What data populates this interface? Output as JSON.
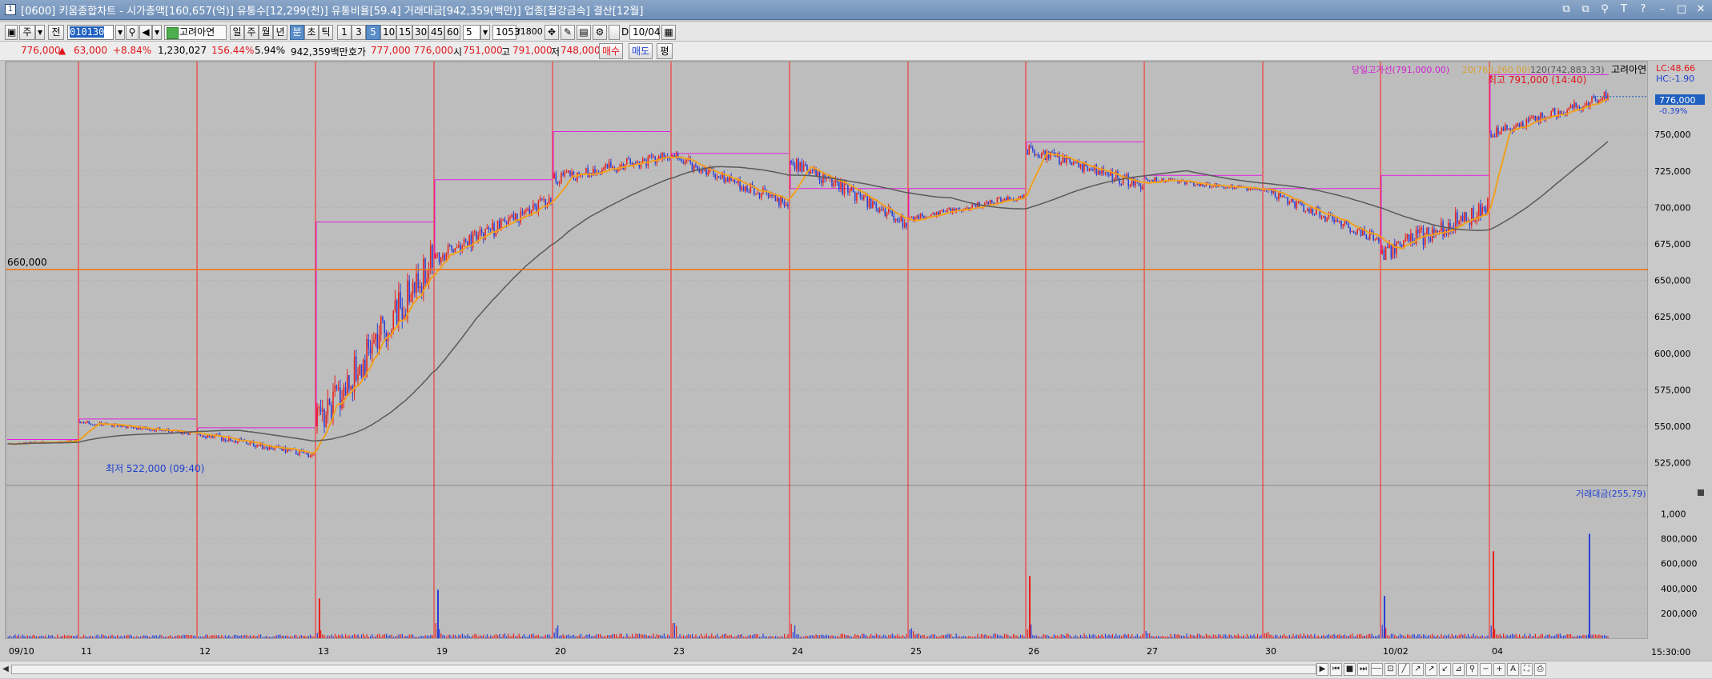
{
  "window": {
    "title": "[0600] 키움종합차트 - 시가총액[160,657(억)] 유통수[12,299(천)] 유통비율[59.4] 거래대금[942,359(백만)] 업종[철강금속] 결산[12월]",
    "app_icon": "1",
    "buttons": [
      "⧉",
      "⧉",
      "⚲",
      "T",
      "?",
      "–",
      "□",
      "✕"
    ]
  },
  "toolbar": {
    "type_label": "주",
    "prev_label": "전",
    "code_value": "010130",
    "stock_name": "고려아연",
    "periods": [
      "일",
      "주",
      "월",
      "년",
      "분",
      "초",
      "틱"
    ],
    "active_period": "분",
    "intervals": [
      "1",
      "3",
      "5",
      "10",
      "15",
      "30",
      "45",
      "60"
    ],
    "active_interval": "5",
    "interval_select": "5",
    "count_value": "1053",
    "count_total": "/1800",
    "date_value": "10/04"
  },
  "quote": {
    "price": "776,000",
    "change_arrow": "▲",
    "change": "63,000",
    "change_pct": "+8.84%",
    "volume": "1,230,027",
    "volume_ratio": "156.44%",
    "turnover": "5.94%",
    "trade_amount": "942,359백만",
    "ask_label": "호가",
    "ask_values": "777,000 776,000",
    "open_label": "시",
    "open_value": "751,000",
    "high_label": "고",
    "high_value": "791,000",
    "low_label": "저",
    "low_value": "748,000",
    "buy_label": "매수",
    "sell_label": "매도",
    "avg_label": "평"
  },
  "legend": {
    "prev_high_line": "당일고가선(791,000.00)",
    "ma_short": "20(760,260.00)",
    "ma_long": "120(742,883.33)",
    "stock": "고려아연",
    "lc": "LC:48.66",
    "hc": "HC:-1.90",
    "price_flag": "776,000",
    "price_flag_pct": "-0.39%",
    "volume_panel": "거래대금(255,79)"
  },
  "annotations": {
    "high": "최고 791,000 (14:40)",
    "low": "최저 522,000 (09:40)",
    "ref_line": "660,000"
  },
  "axis": {
    "price_ticks": [
      "750,000",
      "725,000",
      "700,000",
      "675,000",
      "650,000",
      "625,000",
      "600,000",
      "575,000",
      "550,000",
      "525,000"
    ],
    "volume_ticks": [
      "1,000",
      "800,000",
      "600,000",
      "400,000",
      "200,000"
    ],
    "dates": [
      "09/10",
      "11",
      "12",
      "13",
      "19",
      "20",
      "23",
      "24",
      "25",
      "26",
      "27",
      "30",
      "10/02",
      "04"
    ],
    "time_label": "15:30:00"
  },
  "colors": {
    "up": "#e8201a",
    "down": "#2a3fd6",
    "ma20": "#f0a020",
    "ma120": "#5a5a5a",
    "day_high_line": "#e020e0",
    "ref_line": "#f07010",
    "session_line": "#ff2020",
    "panel_bg": "#bdbdbd"
  },
  "chart_data": {
    "type": "candlestick",
    "title": "",
    "xlabel": "",
    "ylabel": "",
    "ylim": [
      510000,
      800000
    ],
    "volume_ylim": [
      0,
      1100
    ],
    "sessions": [
      {
        "date": "09/10",
        "open": 538000,
        "high": 542000,
        "low": 534000,
        "close": 540000,
        "day_high": 541000
      },
      {
        "date": "11",
        "open": 553000,
        "high": 555000,
        "low": 540000,
        "close": 545000,
        "day_high": 555000
      },
      {
        "date": "12",
        "open": 545000,
        "high": 548000,
        "low": 522000,
        "close": 530000,
        "day_high": 549000
      },
      {
        "date": "13",
        "open": 550000,
        "high": 690000,
        "low": 545000,
        "close": 663000,
        "day_high": 690000
      },
      {
        "date": "19",
        "open": 665000,
        "high": 720000,
        "low": 660000,
        "close": 705000,
        "day_high": 719000
      },
      {
        "date": "20",
        "open": 720000,
        "high": 752000,
        "low": 705000,
        "close": 735000,
        "day_high": 752000
      },
      {
        "date": "23",
        "open": 735000,
        "high": 740000,
        "low": 695000,
        "close": 702000,
        "day_high": 737000
      },
      {
        "date": "24",
        "open": 732000,
        "high": 738000,
        "low": 682000,
        "close": 690000,
        "day_high": 713000
      },
      {
        "date": "25",
        "open": 692000,
        "high": 715000,
        "low": 690000,
        "close": 708000,
        "day_high": 713000
      },
      {
        "date": "26",
        "open": 740000,
        "high": 745000,
        "low": 700000,
        "close": 715000,
        "day_high": 745000
      },
      {
        "date": "27",
        "open": 720000,
        "high": 724000,
        "low": 705000,
        "close": 712000,
        "day_high": 722000
      },
      {
        "date": "30",
        "open": 712000,
        "high": 713000,
        "low": 672000,
        "close": 678000,
        "day_high": 713000
      },
      {
        "date": "10/02",
        "open": 668000,
        "high": 738000,
        "low": 664000,
        "close": 700000,
        "day_high": 722000
      },
      {
        "date": "04",
        "open": 751000,
        "high": 791000,
        "low": 748000,
        "close": 776000,
        "day_high": 791000
      }
    ],
    "volume_peaks": [
      {
        "date": "13",
        "value": 320
      },
      {
        "date": "19",
        "value": 390
      },
      {
        "date": "26",
        "value": 500
      },
      {
        "date": "10/02",
        "value": 340
      },
      {
        "date": "04",
        "value": 700
      },
      {
        "date": "04",
        "value": 840
      }
    ],
    "ref_price": 660000,
    "last_price": 776000
  }
}
